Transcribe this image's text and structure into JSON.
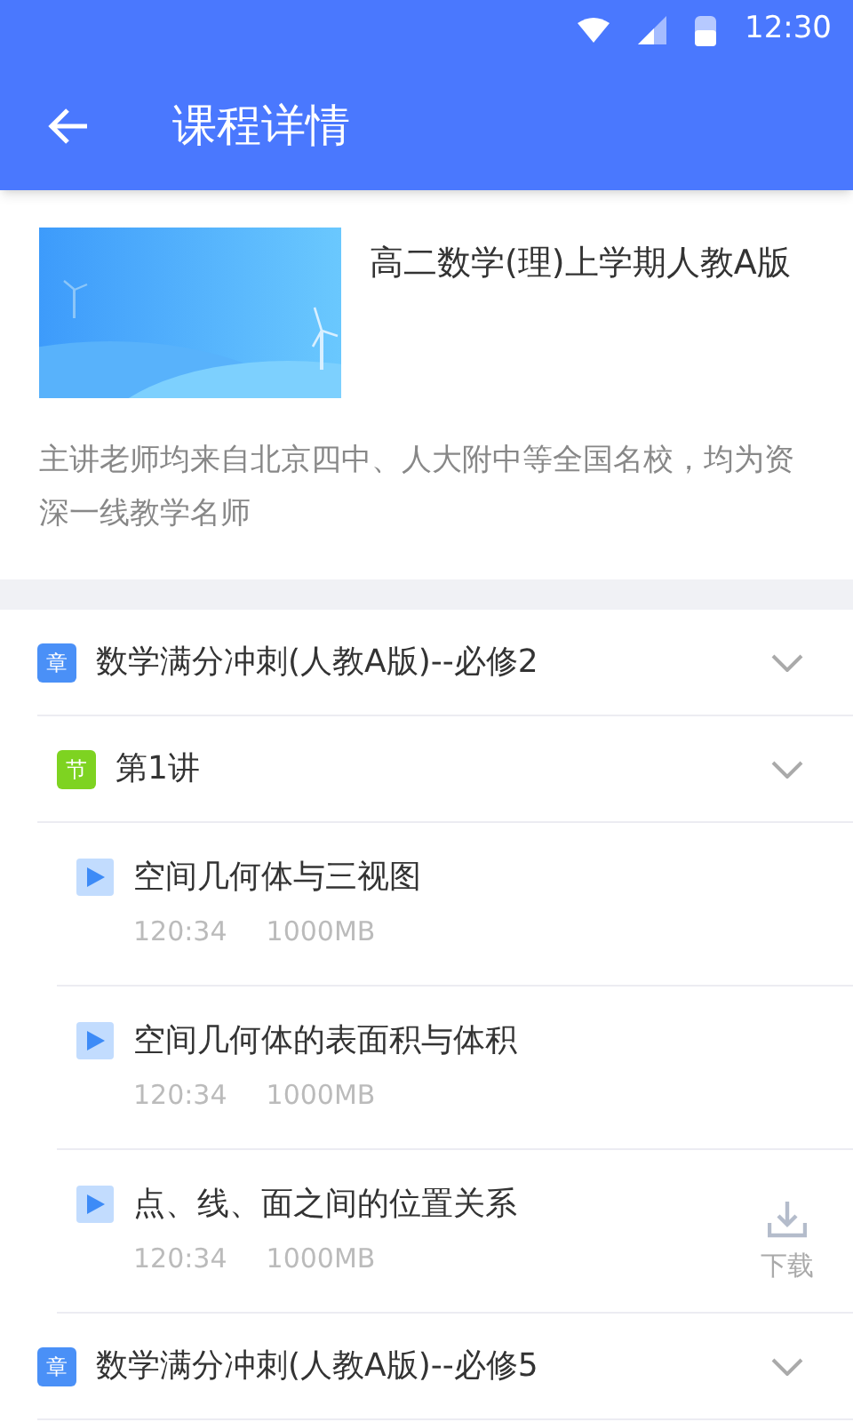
{
  "status_bar": {
    "time": "12:30"
  },
  "app_bar": {
    "title": "课程详情"
  },
  "course": {
    "title": "高二数学(理)上学期人教A版",
    "description": "主讲老师均来自北京四中、人大附中等全国名校，均为资深一线教学名师"
  },
  "chapters": [
    {
      "tag": "章",
      "title": "数学满分冲刺(人教A版)--必修2",
      "children": [
        {
          "tag": "节",
          "title": "第1讲",
          "children": [
            {
              "title": "空间几何体与三视图",
              "duration": "120:34",
              "size": "1000MB"
            },
            {
              "title": "空间几何体的表面积与体积",
              "duration": "120:34",
              "size": "1000MB"
            },
            {
              "title": "点、线、面之间的位置关系",
              "duration": "120:34",
              "size": "1000MB",
              "download": {
                "label": "下载"
              }
            }
          ]
        }
      ]
    },
    {
      "tag": "章",
      "title": "数学满分冲刺(人教A版)--必修5"
    }
  ]
}
